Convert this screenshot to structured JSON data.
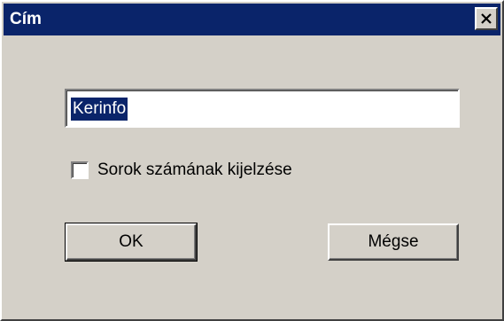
{
  "window": {
    "title": "Cím",
    "close_icon": "close-icon"
  },
  "form": {
    "title_field_value": "Kerinfo",
    "show_rows_label": "Sorok számának kijelzése",
    "show_rows_checked": false
  },
  "buttons": {
    "ok_label": "OK",
    "cancel_label": "Mégse"
  },
  "colors": {
    "titlebar": "#0a246a",
    "dialog_bg": "#d4d0c8",
    "selection": "#0a246a"
  }
}
